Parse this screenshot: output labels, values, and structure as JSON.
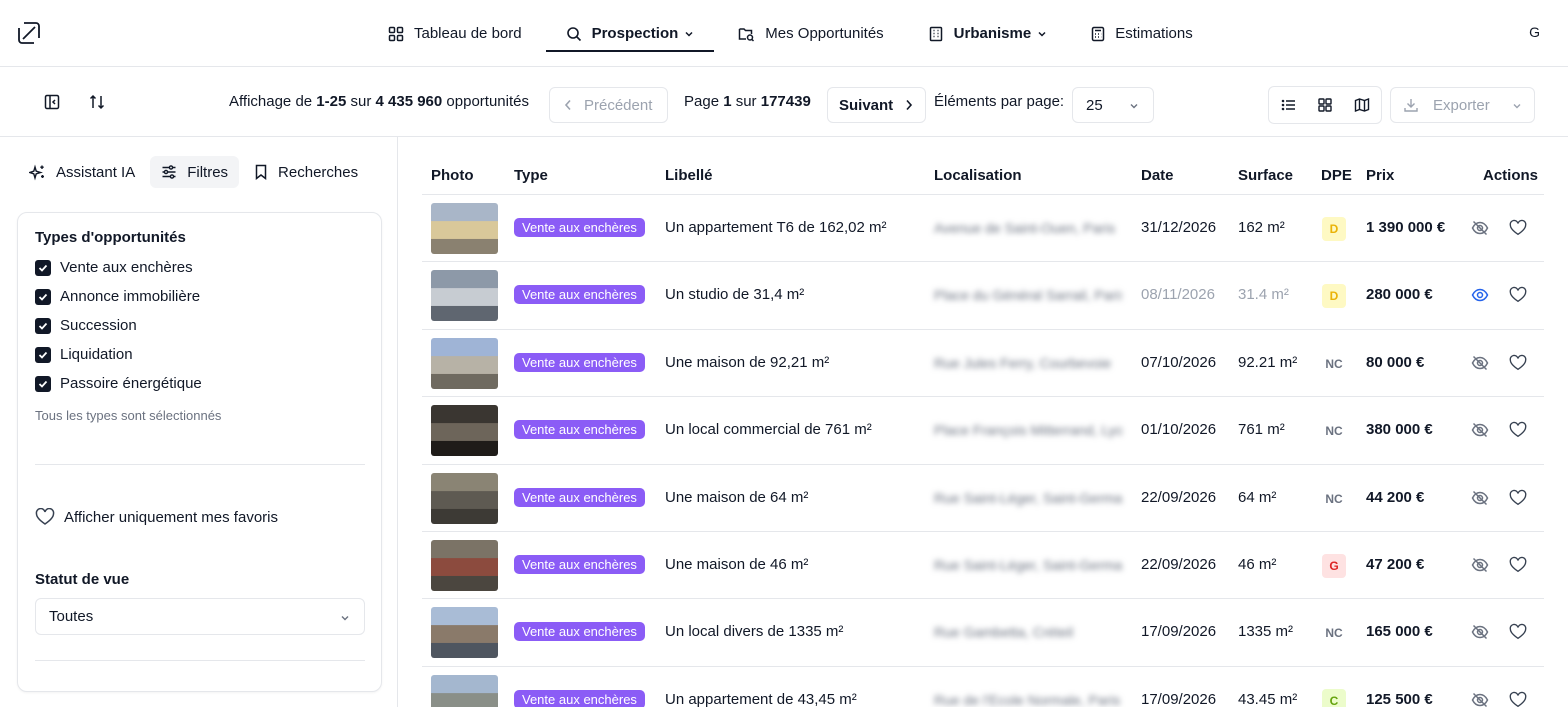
{
  "nav": {
    "items": [
      {
        "label": "Tableau de bord",
        "icon": "dashboard-icon"
      },
      {
        "label": "Prospection",
        "icon": "search-icon",
        "dropdown": true,
        "active": true
      },
      {
        "label": "Mes Opportunités",
        "icon": "folder-icon"
      },
      {
        "label": "Urbanisme",
        "icon": "building-icon",
        "dropdown": true
      },
      {
        "label": "Estimations",
        "icon": "calculator-icon"
      }
    ],
    "user_initial": "G"
  },
  "toolbar": {
    "showing_prefix": "Affichage de ",
    "range": "1-25",
    "of": " sur ",
    "total": "4 435 960",
    "unit": " opportunités",
    "prev_label": "Précédent",
    "page_prefix": "Page ",
    "page_current": "1",
    "page_of": " sur ",
    "page_total": "177439",
    "next_label": "Suivant",
    "per_page_label": "Éléments par page:",
    "per_page_value": "25",
    "export_label": "Exporter"
  },
  "sidebar": {
    "tabs": [
      {
        "label": "Assistant IA",
        "icon": "sparkle-icon"
      },
      {
        "label": "Filtres",
        "icon": "sliders-icon",
        "active": true
      },
      {
        "label": "Recherches",
        "icon": "bookmark-icon"
      }
    ],
    "types_title": "Types d'opportunités",
    "types": [
      {
        "label": "Vente aux enchères",
        "checked": true
      },
      {
        "label": "Annonce immobilière",
        "checked": true
      },
      {
        "label": "Succession",
        "checked": true
      },
      {
        "label": "Liquidation",
        "checked": true
      },
      {
        "label": "Passoire énergétique",
        "checked": true
      }
    ],
    "types_hint": "Tous les types sont sélectionnés",
    "favorites_label": "Afficher uniquement mes favoris",
    "statut_label": "Statut de vue",
    "statut_value": "Toutes"
  },
  "table": {
    "headers": {
      "photo": "Photo",
      "type": "Type",
      "libelle": "Libellé",
      "localisation": "Localisation",
      "date": "Date",
      "surface": "Surface",
      "dpe": "DPE",
      "prix": "Prix",
      "actions": "Actions"
    },
    "rows": [
      {
        "type": "Vente aux enchères",
        "libelle": "Un appartement T6 de 162,02 m²",
        "localisation": "Avenue de Saint-Ouen, Paris",
        "date": "31/12/2026",
        "surface": "162 m²",
        "dpe": "D",
        "prix": "1 390 000 €",
        "viewed": false,
        "photo_colors": [
          "#a9b6c8",
          "#d9c89a",
          "#8a8170"
        ]
      },
      {
        "type": "Vente aux enchères",
        "libelle": "Un studio de 31,4 m²",
        "localisation": "Place du Général Sarrail, Paris",
        "date": "08/11/2026",
        "surface": "31.4 m²",
        "dpe": "D",
        "prix": "280 000 €",
        "viewed": true,
        "photo_colors": [
          "#8d99a8",
          "#c7ccd2",
          "#5f6670"
        ]
      },
      {
        "type": "Vente aux enchères",
        "libelle": "Une maison de 92,21 m²",
        "localisation": "Rue Jules Ferry, Courbevoie",
        "date": "07/10/2026",
        "surface": "92.21 m²",
        "dpe": "NC",
        "prix": "80 000 €",
        "viewed": false,
        "photo_colors": [
          "#9fb4d6",
          "#b7b2a6",
          "#6f6a60"
        ]
      },
      {
        "type": "Vente aux enchères",
        "libelle": "Un local commercial de 761 m²",
        "localisation": "Place François Mitterrand, Lyon",
        "date": "01/10/2026",
        "surface": "761 m²",
        "dpe": "NC",
        "prix": "380 000 €",
        "viewed": false,
        "photo_colors": [
          "#3a3631",
          "#6d655a",
          "#1f1c19"
        ]
      },
      {
        "type": "Vente aux enchères",
        "libelle": "Une maison de 64 m²",
        "localisation": "Rue Saint-Léger, Saint-Germain",
        "date": "22/09/2026",
        "surface": "64 m²",
        "dpe": "NC",
        "prix": "44 200 €",
        "viewed": false,
        "photo_colors": [
          "#8a8474",
          "#5e5a52",
          "#3d3a35"
        ]
      },
      {
        "type": "Vente aux enchères",
        "libelle": "Une maison de 46 m²",
        "localisation": "Rue Saint-Léger, Saint-Germain",
        "date": "22/09/2026",
        "surface": "46 m²",
        "dpe": "G",
        "prix": "47 200 €",
        "viewed": false,
        "photo_colors": [
          "#7b7366",
          "#8c4b3e",
          "#4b463f"
        ]
      },
      {
        "type": "Vente aux enchères",
        "libelle": "Un local divers de 1335 m²",
        "localisation": "Rue Gambetta, Créteil",
        "date": "17/09/2026",
        "surface": "1335 m²",
        "dpe": "NC",
        "prix": "165 000 €",
        "viewed": false,
        "photo_colors": [
          "#a9bcd6",
          "#8a7a6a",
          "#4f5660"
        ]
      },
      {
        "type": "Vente aux enchères",
        "libelle": "Un appartement de 43,45 m²",
        "localisation": "Rue de l'Ecole Normale, Paris",
        "date": "17/09/2026",
        "surface": "43.45 m²",
        "dpe": "C",
        "prix": "125 500 €",
        "viewed": false,
        "photo_colors": [
          "#a4b7cf",
          "#8a8f88",
          "#5d6a5d"
        ]
      }
    ]
  },
  "colors": {
    "badge": "#8b5cf6",
    "dpe_D": "#fef9c3",
    "dpe_D_text": "#eab308",
    "dpe_G": "#fee2e2",
    "dpe_G_text": "#dc2626",
    "dpe_C": "#ecfccb",
    "dpe_C_text": "#65a30d",
    "eye_active": "#2563eb"
  }
}
